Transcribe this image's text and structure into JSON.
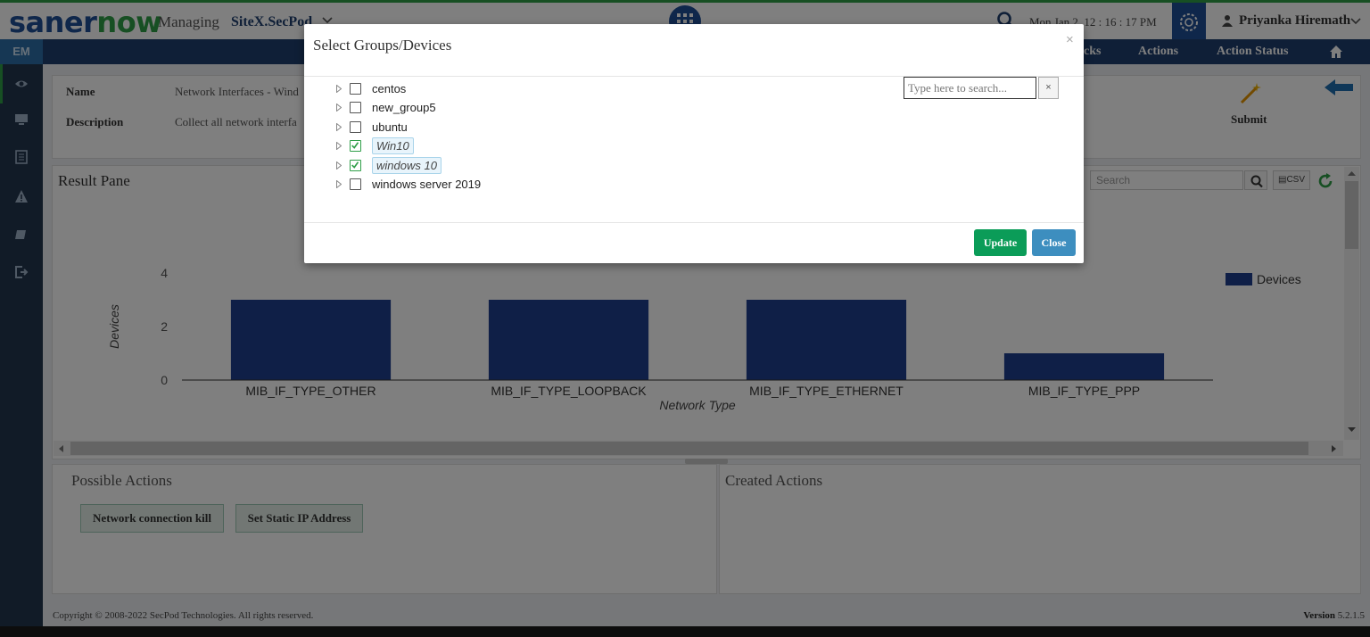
{
  "header": {
    "logo_part1": "saner",
    "logo_part2": "now",
    "managing_label": "Managing",
    "site_name": "SiteX.SecPod",
    "datetime": "Mon Jan 2, 12 : 16 : 17 PM",
    "user_name": "Priyanka Hiremath"
  },
  "nav": {
    "section_tag": "EM",
    "items": [
      "cks",
      "Actions",
      "Action Status"
    ]
  },
  "info": {
    "name_label": "Name",
    "name_value": "Network Interfaces - Wind",
    "description_label": "Description",
    "description_value": "Collect all network interfa",
    "submit_label": "Submit"
  },
  "result_pane": {
    "title": "Result Pane",
    "search_placeholder": "Search",
    "csv_label": "CSV"
  },
  "chart_data": {
    "type": "bar",
    "categories": [
      "MIB_IF_TYPE_OTHER",
      "MIB_IF_TYPE_LOOPBACK",
      "MIB_IF_TYPE_ETHERNET",
      "MIB_IF_TYPE_PPP"
    ],
    "series": [
      {
        "name": "Devices",
        "values": [
          3,
          3,
          3,
          1
        ]
      }
    ],
    "xlabel": "Network Type",
    "ylabel": "Devices",
    "ylim": [
      0,
      4
    ],
    "yticks": [
      0,
      2,
      4
    ],
    "legend": "top-right",
    "grid": false,
    "color": "#1f3f8f"
  },
  "possible_actions": {
    "title": "Possible Actions",
    "buttons": [
      "Network connection kill",
      "Set Static IP Address"
    ]
  },
  "created_actions": {
    "title": "Created Actions"
  },
  "footer": {
    "copyright": "Copyright © 2008-2022 SecPod Technologies. All rights reserved.",
    "version_label": "Version",
    "version_value": "5.2.1.5"
  },
  "modal": {
    "title": "Select Groups/Devices",
    "close_glyph": "×",
    "search_placeholder": "Type here to search...",
    "search_clear": "×",
    "groups": [
      {
        "label": "centos",
        "checked": false
      },
      {
        "label": "new_group5",
        "checked": false
      },
      {
        "label": "ubuntu",
        "checked": false
      },
      {
        "label": "Win10",
        "checked": true
      },
      {
        "label": "windows 10",
        "checked": true
      },
      {
        "label": "windows server 2019",
        "checked": false
      }
    ],
    "update_label": "Update",
    "close_label": "Close"
  },
  "colors": {
    "brand_blue": "#1f4f96",
    "brand_green": "#2e9e47",
    "nav_bg": "#1f3f6e",
    "update_green": "#0b9c58",
    "close_blue": "#3d8ebf"
  }
}
